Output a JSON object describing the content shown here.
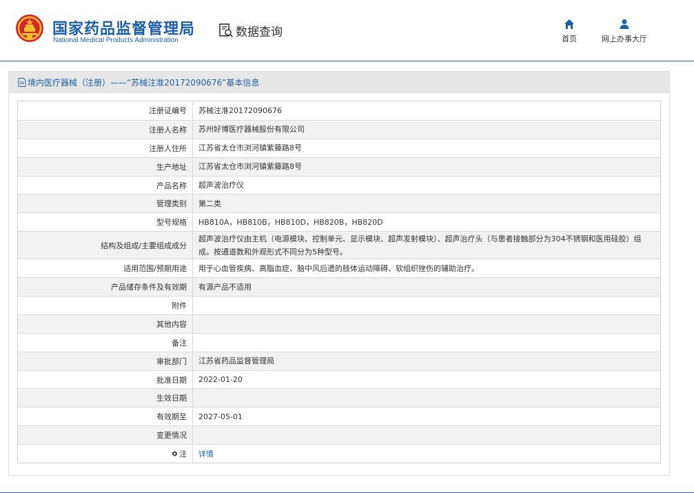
{
  "header": {
    "logo_cn": "国家药品监督管理局",
    "logo_en": "National Medical Products Administration",
    "query_label": "数据查询",
    "nav": {
      "home": "首页",
      "hall": "网上办事大厅"
    }
  },
  "panel": {
    "title": "境内医疗器械（注册）——“苏械注准20172090676”基本信息"
  },
  "rows": [
    {
      "label": "注册证编号",
      "value": "苏械注准20172090676"
    },
    {
      "label": "注册人名称",
      "value": "苏州好博医疗器械股份有限公司"
    },
    {
      "label": "注册人住所",
      "value": "江苏省太仓市浏河镇紫藤路8号"
    },
    {
      "label": "生产地址",
      "value": "江苏省太仓市浏河镇紫藤路8号"
    },
    {
      "label": "产品名称",
      "value": "超声波治疗仪"
    },
    {
      "label": "管理类别",
      "value": "第二类"
    },
    {
      "label": "型号规格",
      "value": "HB810A，HB810B，HB810D，HB820B，HB820D"
    },
    {
      "label": "结构及组成/主要组成成分",
      "value": "超声波治疗仪由主机（电源模块、控制单元、显示模块、超声发射模块）、超声治疗头（与患者接触部分为304不锈钢和医用硅胶）组成。按通道数和外观形式不同分为5种型号。"
    },
    {
      "label": "适用范围/预期用途",
      "value": "用于心血管疾病、高脂血症、脑中风后遗的肢体运动障碍、软组织挫伤的辅助治疗。"
    },
    {
      "label": "产品储存条件及有效期",
      "value": "有源产品不适用"
    },
    {
      "label": "附件",
      "value": ""
    },
    {
      "label": "其他内容",
      "value": ""
    },
    {
      "label": "备注",
      "value": ""
    },
    {
      "label": "审批部门",
      "value": "江苏省药品监督管理局"
    },
    {
      "label": "批准日期",
      "value": "2022-01-20"
    },
    {
      "label": "生效日期",
      "value": ""
    },
    {
      "label": "有效期至",
      "value": "2027-05-01"
    },
    {
      "label": "变更情况",
      "value": ""
    },
    {
      "label": "注",
      "value": "详情"
    }
  ],
  "colors": {
    "brand_blue": "#1c5fa8",
    "emblem_red": "#d7262b",
    "emblem_gold": "#f2c12e"
  }
}
